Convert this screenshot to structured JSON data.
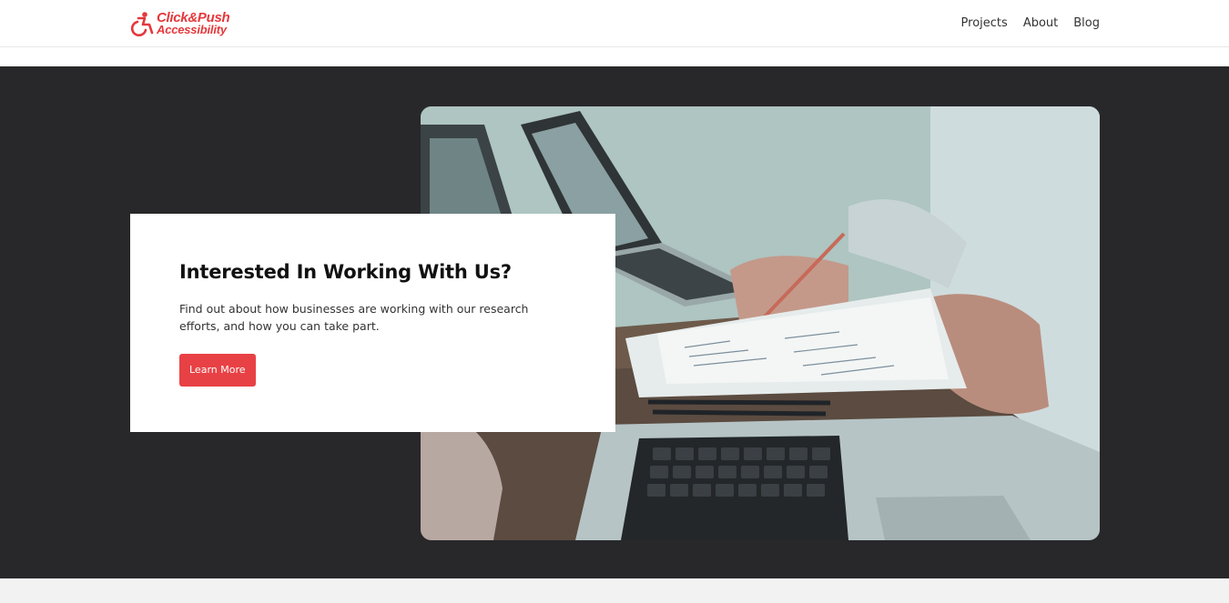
{
  "header": {
    "logo": {
      "line1": "Click&Push",
      "line2": "Accessibility",
      "icon": "wheelchair-icon",
      "color": "#e5383b"
    },
    "nav": [
      {
        "label": "Projects"
      },
      {
        "label": "About"
      },
      {
        "label": "Blog"
      }
    ]
  },
  "hero": {
    "image": "people-working-laptops-photo",
    "card": {
      "title": "Interested In Working With Us?",
      "description": "Find out about how businesses are working with our research efforts, and how you can take part.",
      "button_label": "Learn More"
    }
  },
  "colors": {
    "accent": "#e84145",
    "hero_bg": "#28282a",
    "footer_bg": "#f2f2f2"
  }
}
